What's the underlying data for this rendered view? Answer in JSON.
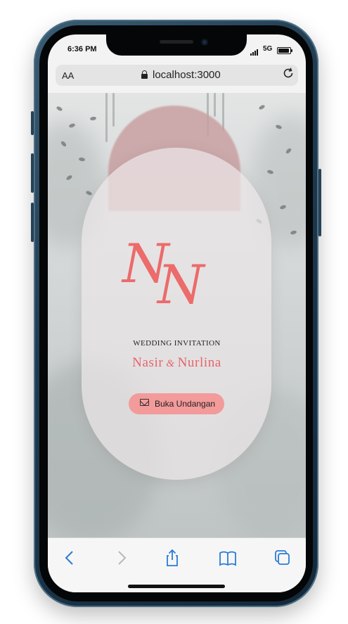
{
  "status_bar": {
    "time": "6:36 PM",
    "network": "5G"
  },
  "browser": {
    "text_size_label": "AA",
    "url": "localhost:3000"
  },
  "invitation": {
    "monogram_first": "N",
    "monogram_second": "N",
    "subtitle": "WEDDING INVITATION",
    "name_left": "Nasir",
    "ampersand": "&",
    "name_right": "Nurlina",
    "open_button_label": "Buka Undangan"
  },
  "colors": {
    "accent": "#ec6b6b",
    "button_bg": "#f39a9b",
    "arch_pink": "#c9a0a2",
    "phone_frame": "#1f3a4e"
  },
  "icons": {
    "toolbar": [
      "back-icon",
      "forward-icon",
      "share-icon",
      "bookmarks-icon",
      "tabs-icon"
    ],
    "address_bar": [
      "lock-icon",
      "reload-icon"
    ],
    "button": "envelope-icon"
  }
}
